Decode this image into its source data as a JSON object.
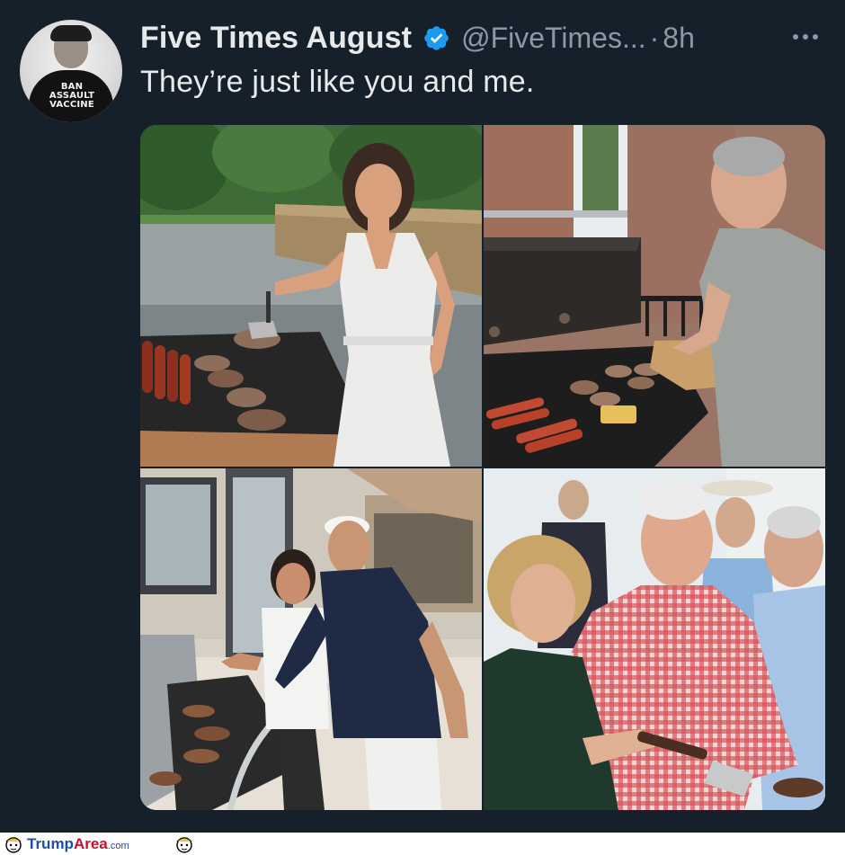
{
  "tweet": {
    "display_name": "Five Times August",
    "handle": "@FiveTimes...",
    "separator": "·",
    "time": "8h",
    "text": "They’re just like you and me.",
    "avatar_shirt_text": "BAN\nASSAULT\nVACCINE",
    "icons": {
      "verified": "verified-badge-icon",
      "more": "more-options-icon"
    },
    "colors": {
      "background": "#15202b",
      "primary_text": "#e7e9ea",
      "secondary_text": "#8b98a5",
      "verified_blue": "#1d9bf0"
    }
  },
  "media": {
    "photos": [
      {
        "name": "photo-grilling-woman-white-dress"
      },
      {
        "name": "photo-grilling-man-gray-shirt"
      },
      {
        "name": "photo-grilling-couple-white-cap"
      },
      {
        "name": "photo-grilling-couple-red-gingham"
      }
    ]
  },
  "watermark": {
    "brand_part1": "Trump",
    "brand_part2": "Area",
    "brand_suffix": ".com"
  }
}
